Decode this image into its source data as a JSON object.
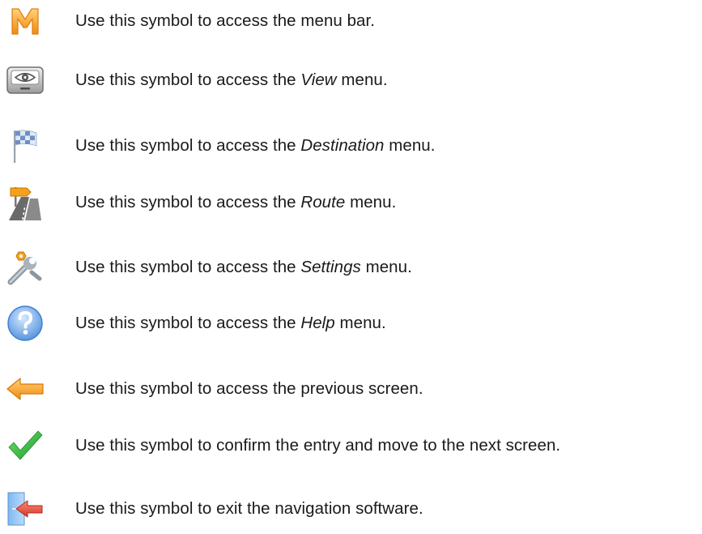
{
  "legend": {
    "items": [
      {
        "icon": "menu-bar-icon",
        "pre": "Use this symbol to access the menu bar.",
        "em": "",
        "post": ""
      },
      {
        "icon": "view-eye-icon",
        "pre": "Use this symbol to access the ",
        "em": "View",
        "post": " menu."
      },
      {
        "icon": "checkered-flag-icon",
        "pre": "Use this symbol to access the ",
        "em": "Destination",
        "post": " menu."
      },
      {
        "icon": "route-signpost-icon",
        "pre": "Use this symbol to access the ",
        "em": "Route",
        "post": " menu."
      },
      {
        "icon": "settings-wrench-icon",
        "pre": "Use this symbol to access the ",
        "em": "Settings",
        "post": " menu."
      },
      {
        "icon": "help-question-icon",
        "pre": "Use this symbol to access the ",
        "em": "Help",
        "post": " menu."
      },
      {
        "icon": "back-arrow-icon",
        "pre": "Use this symbol to access the previous screen.",
        "em": "",
        "post": ""
      },
      {
        "icon": "confirm-check-icon",
        "pre": "Use this symbol to confirm the entry and move to the next screen.",
        "em": "",
        "post": ""
      },
      {
        "icon": "exit-door-icon",
        "pre": "Use this symbol to exit the navigation software.",
        "em": "",
        "post": ""
      }
    ]
  },
  "colors": {
    "text": "#1a1a1a",
    "menu_orange": "#f7a21b",
    "help_blue": "#5a9be0",
    "check_green": "#3cb93c",
    "arrow_orange": "#f39c12",
    "exit_red": "#d9443a"
  }
}
